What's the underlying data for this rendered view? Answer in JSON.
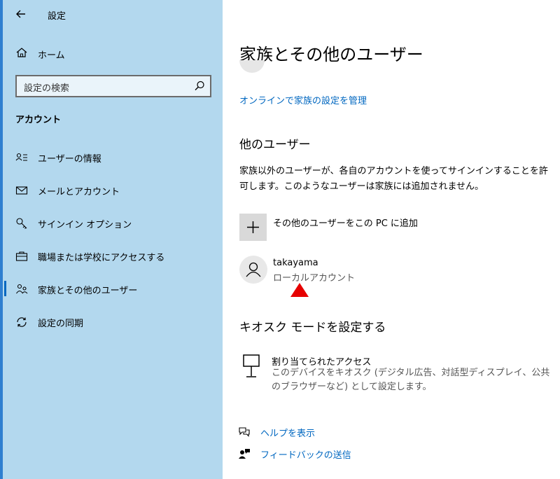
{
  "window": {
    "title": "設定",
    "back_icon": "back-arrow-icon"
  },
  "sidebar": {
    "home_label": "ホーム",
    "search_placeholder": "設定の検索",
    "section_title": "アカウント",
    "items": [
      {
        "label": "ユーザーの情報",
        "icon": "user-info-icon"
      },
      {
        "label": "メールとアカウント",
        "icon": "mail-icon"
      },
      {
        "label": "サインイン オプション",
        "icon": "key-icon"
      },
      {
        "label": "職場または学校にアクセスする",
        "icon": "briefcase-icon"
      },
      {
        "label": "家族とその他のユーザー",
        "icon": "family-icon",
        "selected": true
      },
      {
        "label": "設定の同期",
        "icon": "sync-icon"
      }
    ],
    "background_color": "#b3d8ee",
    "accent_color": "#0067c0"
  },
  "main": {
    "title": "家族とその他のユーザー",
    "manage_family_link": "オンラインで家族の設定を管理",
    "other_users": {
      "title": "他のユーザー",
      "description": "家族以外のユーザーが、各自のアカウントを使ってサインインすることを許可します。このようなユーザーは家族には追加されません。",
      "add_label": "その他のユーザーをこの PC に追加",
      "user": {
        "name": "takayama",
        "type": "ローカルアカウント"
      }
    },
    "kiosk": {
      "title": "キオスク モードを設定する",
      "label": "割り当てられたアクセス",
      "description": "このデバイスをキオスク (デジタル広告、対話型ディスプレイ、公共のブラウザーなど) として設定します。"
    },
    "help": {
      "help_label": "ヘルプを表示",
      "feedback_label": "フィードバックの送信"
    },
    "annotation_color": "#e60000"
  }
}
